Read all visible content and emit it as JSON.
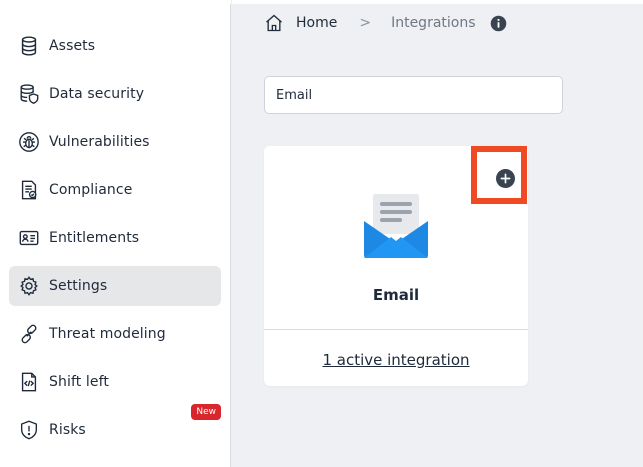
{
  "sidebar": {
    "items": [
      {
        "label": "Assets",
        "icon": "database-icon"
      },
      {
        "label": "Data security",
        "icon": "database-shield-icon"
      },
      {
        "label": "Vulnerabilities",
        "icon": "bug-icon"
      },
      {
        "label": "Compliance",
        "icon": "compliance-doc-icon"
      },
      {
        "label": "Entitlements",
        "icon": "id-card-icon"
      },
      {
        "label": "Settings",
        "icon": "gear-icon",
        "active": true
      },
      {
        "label": "Threat modeling",
        "icon": "chain-link-icon"
      },
      {
        "label": "Shift left",
        "icon": "code-file-icon"
      },
      {
        "label": "Risks",
        "icon": "shield-alert-icon",
        "badge": "New"
      }
    ]
  },
  "breadcrumb": {
    "home": "Home",
    "separator": ">",
    "current": "Integrations"
  },
  "search": {
    "value": "Email"
  },
  "card": {
    "title": "Email",
    "link": "1 active integration",
    "icon": "email-icon",
    "add_icon": "plus-circle-icon"
  },
  "colors": {
    "highlight": "#f04a24",
    "accent_blue": "#1e88e5",
    "badge": "#d9262c",
    "active_bg": "#e6e7e9"
  }
}
